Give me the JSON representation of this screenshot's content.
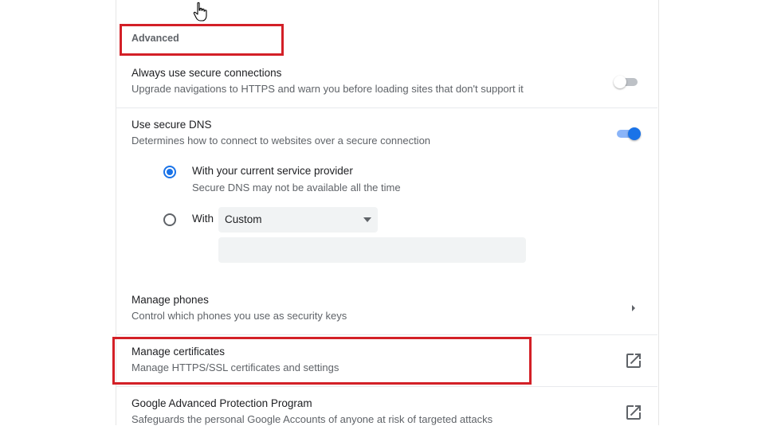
{
  "advanced": {
    "label": "Advanced"
  },
  "secure_connections": {
    "title": "Always use secure connections",
    "description": "Upgrade navigations to HTTPS and warn you before loading sites that don't support it",
    "enabled": false
  },
  "secure_dns": {
    "title": "Use secure DNS",
    "description": "Determines how to connect to websites over a secure connection",
    "enabled": true,
    "option_current": {
      "label": "With your current service provider",
      "sublabel": "Secure DNS may not be available all the time",
      "selected": true
    },
    "option_with": {
      "label": "With",
      "selected": false,
      "dropdown_value": "Custom",
      "custom_input_value": ""
    }
  },
  "manage_phones": {
    "title": "Manage phones",
    "description": "Control which phones you use as security keys",
    "icon": "chevron-right-icon"
  },
  "manage_certificates": {
    "title": "Manage certificates",
    "description": "Manage HTTPS/SSL certificates and settings",
    "icon": "open-in-new-icon"
  },
  "advanced_protection": {
    "title": "Google Advanced Protection Program",
    "description": "Safeguards the personal Google Accounts of anyone at risk of targeted attacks",
    "icon": "open-in-new-icon"
  },
  "colors": {
    "accent": "#1a73e8",
    "highlight": "#d32027"
  },
  "cursor": {
    "icon": "hand-pointer-icon"
  }
}
